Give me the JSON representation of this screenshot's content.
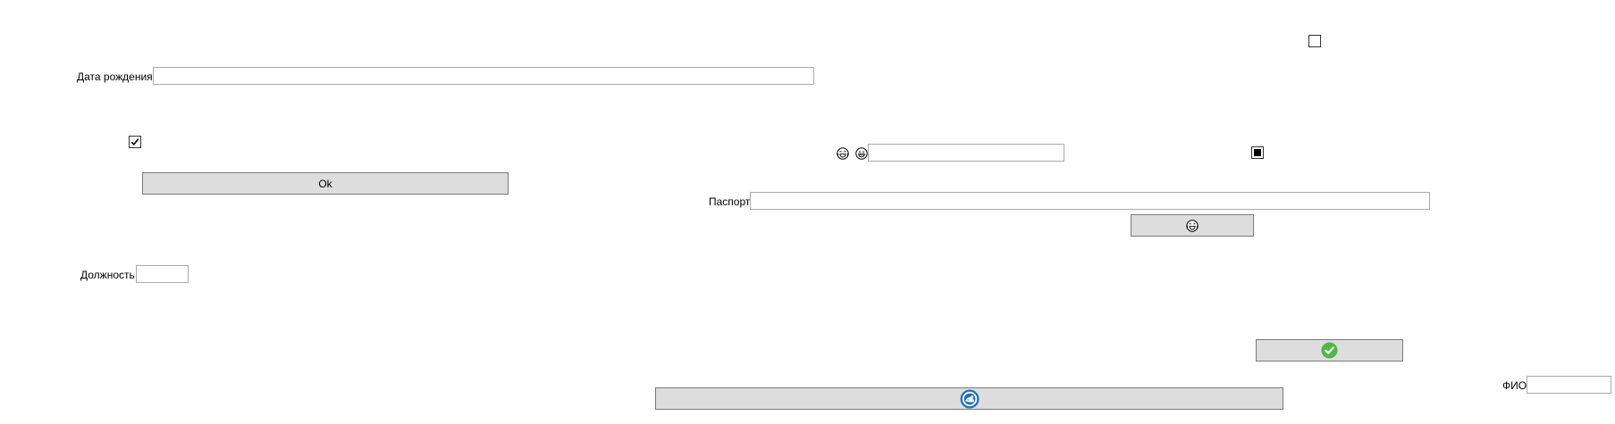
{
  "labels": {
    "birth_date": "Дата рождения",
    "position": "Должность",
    "passport": "Паспорт",
    "full_name": "ФИО"
  },
  "fields": {
    "birth_date": "",
    "position": "",
    "emoji_field": "",
    "passport": "",
    "full_name": ""
  },
  "buttons": {
    "ok_label": "Ok"
  },
  "checkboxes": {
    "top_right": false,
    "left": true,
    "right_indeterminate": "indeterminate"
  },
  "icons": {
    "laugh": "grinning-tears-icon",
    "grin": "grinning-face-icon",
    "check_circle": "check-circle-icon",
    "logo": "blue-circle-logo-icon"
  },
  "colors": {
    "button_bg": "#dddddd",
    "field_border": "#aaaaaa",
    "success_green": "#4cb848",
    "logo_blue": "#1e6fc9"
  }
}
